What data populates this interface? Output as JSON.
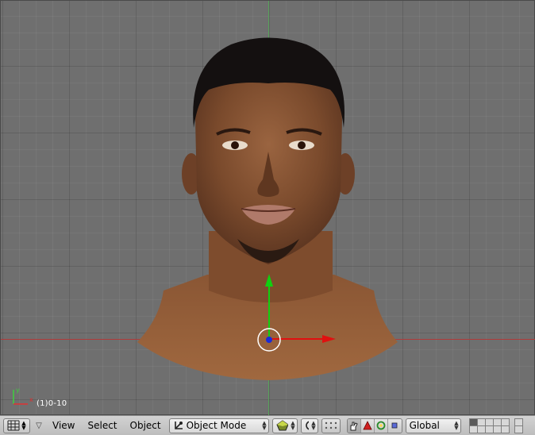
{
  "viewport": {
    "frame_label": "(1)0-10",
    "background": "#6f6f6f",
    "x_axis_color": "#b03a3a",
    "y_axis_color": "#58a35a",
    "gizmo_x_color": "#e01010",
    "gizmo_y_color": "#10d010",
    "origin_color": "#1a2bd6"
  },
  "header": {
    "view_type_icon": "grid-icon",
    "menus": {
      "view": "View",
      "select": "Select",
      "object": "Object"
    },
    "mode": {
      "label": "Object Mode",
      "icon": "object-mode-icon"
    },
    "transform_orientation": "Global",
    "shading_icon": "shaded-sphere-icon",
    "pivot_icon": "pivot-icon",
    "manipulator_icons": [
      "hand-icon",
      "translate-icon",
      "rotate-icon",
      "scale-icon"
    ]
  }
}
